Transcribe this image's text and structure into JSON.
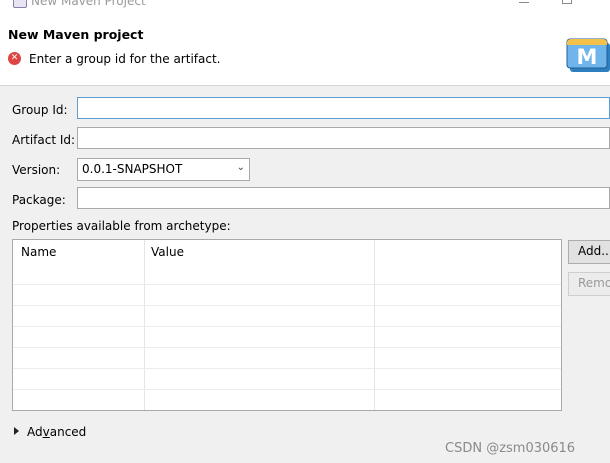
{
  "window": {
    "title": "New Maven Project"
  },
  "header": {
    "title": "New Maven project",
    "message": "Enter a group id for the artifact.",
    "logo_letter": "M"
  },
  "form": {
    "group_id_label": "Group Id:",
    "group_id_value": "",
    "artifact_id_label": "Artifact Id:",
    "artifact_id_value": "",
    "version_label": "Version:",
    "version_value": "0.0.1-SNAPSHOT",
    "package_label": "Package:",
    "package_value": ""
  },
  "properties": {
    "label": "Properties available from archetype:",
    "columns": [
      "Name",
      "Value"
    ],
    "rows": [],
    "add_button": "Add...",
    "remove_button": "Remove"
  },
  "advanced": {
    "label_prefix": "Ad",
    "label_mnemonic": "v",
    "label_suffix": "anced"
  },
  "watermark": "CSDN @zsm030616",
  "colors": {
    "error": "#e04343",
    "focus_border": "#5e9ed6",
    "logo_blue": "#2e7fc0"
  }
}
